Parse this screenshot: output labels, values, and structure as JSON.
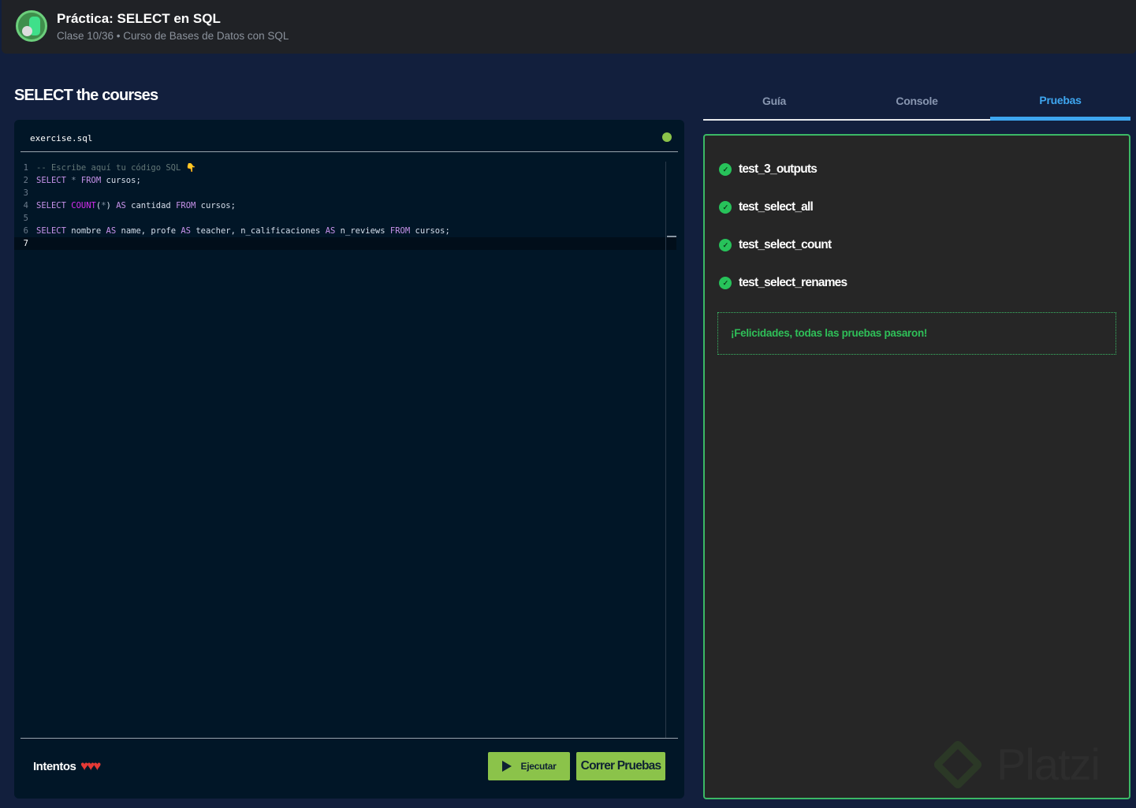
{
  "header": {
    "title": "Práctica: SELECT en SQL",
    "subtitle": "Clase 10/36 • Curso de Bases de Datos con SQL"
  },
  "exercise": {
    "title": "SELECT the courses"
  },
  "editor": {
    "filename": "exercise.sql",
    "lines": [
      [
        [
          "cm",
          "-- Escribe aquí tu código SQL "
        ],
        [
          "emoji",
          "👇"
        ]
      ],
      [
        [
          "kw",
          "SELECT"
        ],
        [
          "op",
          " * "
        ],
        [
          "kw",
          "FROM"
        ],
        [
          "id",
          " cursos;"
        ]
      ],
      [],
      [
        [
          "kw",
          "SELECT"
        ],
        [
          "id",
          " "
        ],
        [
          "fn",
          "COUNT"
        ],
        [
          "id",
          "("
        ],
        [
          "op",
          "*"
        ],
        [
          "id",
          ") "
        ],
        [
          "kw",
          "AS"
        ],
        [
          "id",
          " cantidad "
        ],
        [
          "kw",
          "FROM"
        ],
        [
          "id",
          " cursos;"
        ]
      ],
      [],
      [
        [
          "kw",
          "SELECT"
        ],
        [
          "id",
          " nombre "
        ],
        [
          "kw",
          "AS"
        ],
        [
          "id",
          " name, profe "
        ],
        [
          "kw",
          "AS"
        ],
        [
          "id",
          " teacher, n_calificaciones "
        ],
        [
          "kw",
          "AS"
        ],
        [
          "id",
          " n_reviews "
        ],
        [
          "kw",
          "FROM"
        ],
        [
          "id",
          " cursos;"
        ]
      ],
      []
    ],
    "active_line": 7
  },
  "footer": {
    "attempts_label": "Intentos",
    "hearts": "♥♥♥",
    "run_label": "Ejecutar",
    "test_label": "Correr Pruebas"
  },
  "tabs": [
    {
      "label": "Guía"
    },
    {
      "label": "Console"
    },
    {
      "label": "Pruebas"
    }
  ],
  "tests": [
    {
      "name": "test_3_outputs"
    },
    {
      "name": "test_select_all"
    },
    {
      "name": "test_select_count"
    },
    {
      "name": "test_select_renames"
    }
  ],
  "success_message": "¡Felicidades, todas las pruebas pasaron!",
  "watermark": "Platzi"
}
